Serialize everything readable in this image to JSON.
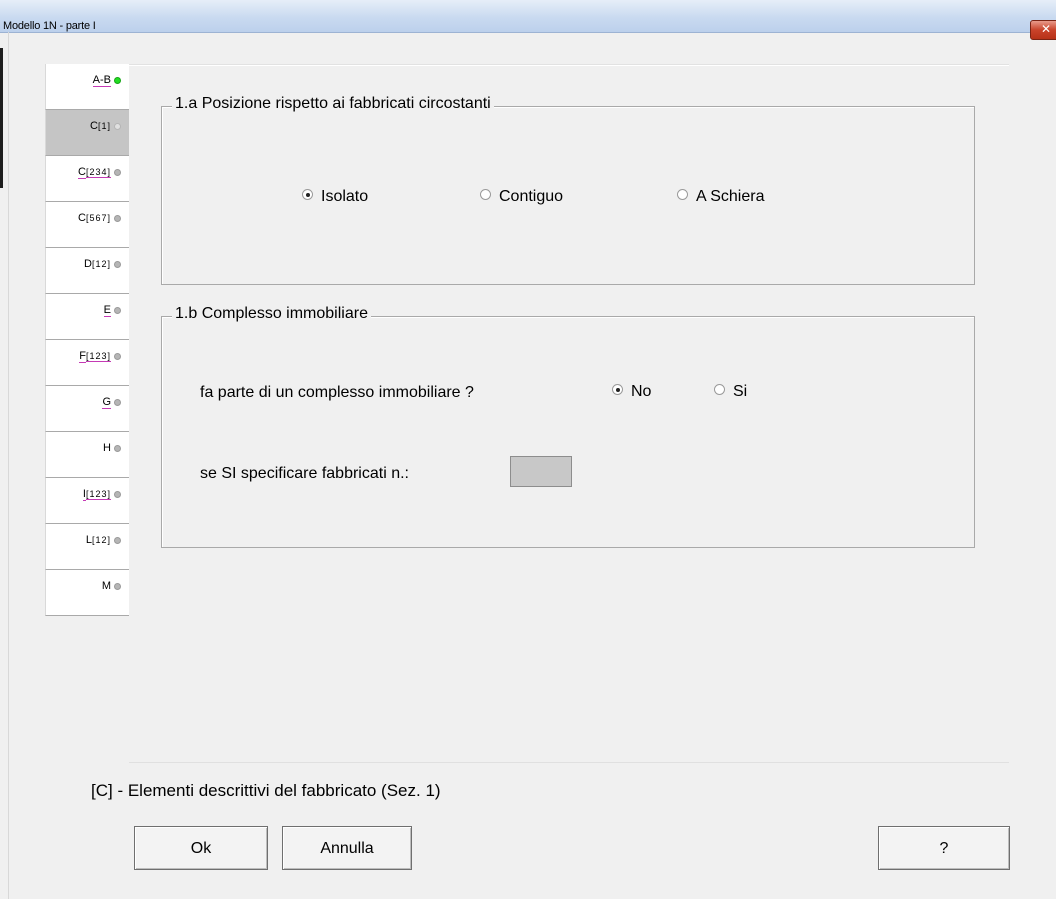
{
  "window": {
    "title": "Modello 1N  -   parte I",
    "close_glyph": "✕"
  },
  "tabs": [
    {
      "main": "A-B",
      "sub": "",
      "underline": true,
      "status": "active",
      "selected": false
    },
    {
      "main": "C",
      "sub": "[1]",
      "underline": false,
      "status": "inactive",
      "selected": true
    },
    {
      "main": "C",
      "sub": "[234]",
      "underline": true,
      "status": "inactive",
      "selected": false
    },
    {
      "main": "C",
      "sub": "[567]",
      "underline": false,
      "status": "inactive",
      "selected": false
    },
    {
      "main": "D",
      "sub": "[12]",
      "underline": false,
      "status": "inactive",
      "selected": false
    },
    {
      "main": "E",
      "sub": "",
      "underline": true,
      "status": "inactive",
      "selected": false
    },
    {
      "main": "F",
      "sub": "[123]",
      "underline": true,
      "status": "inactive",
      "selected": false
    },
    {
      "main": "G",
      "sub": "",
      "underline": true,
      "status": "inactive",
      "selected": false
    },
    {
      "main": "H",
      "sub": "",
      "underline": false,
      "status": "inactive",
      "selected": false
    },
    {
      "main": "I",
      "sub": "[123]",
      "underline": true,
      "status": "inactive",
      "selected": false
    },
    {
      "main": "L",
      "sub": "[12]",
      "underline": false,
      "status": "inactive",
      "selected": false
    },
    {
      "main": "M",
      "sub": "",
      "underline": false,
      "status": "inactive",
      "selected": false
    }
  ],
  "section_a": {
    "title": "1.a  Posizione rispetto ai fabbricati circostanti",
    "options": [
      {
        "label": "Isolato",
        "checked": true
      },
      {
        "label": "Contiguo",
        "checked": false
      },
      {
        "label": "A Schiera",
        "checked": false
      }
    ]
  },
  "section_b": {
    "title": "1.b  Complesso immobiliare",
    "question": "fa parte di un complesso immobiliare ?",
    "options": [
      {
        "label": "No",
        "checked": true
      },
      {
        "label": "Si",
        "checked": false
      }
    ],
    "count_label": "se SI specificare fabbricati n.:",
    "count_value": ""
  },
  "status_text": "[C] - Elementi descrittivi del fabbricato (Sez. 1)",
  "buttons": {
    "ok": "Ok",
    "cancel": "Annulla",
    "help": "?"
  },
  "colors": {
    "active_dot": "#22dd22",
    "inactive_dot": "#b5b5b5",
    "selected_tab": "#c5c5c5"
  }
}
